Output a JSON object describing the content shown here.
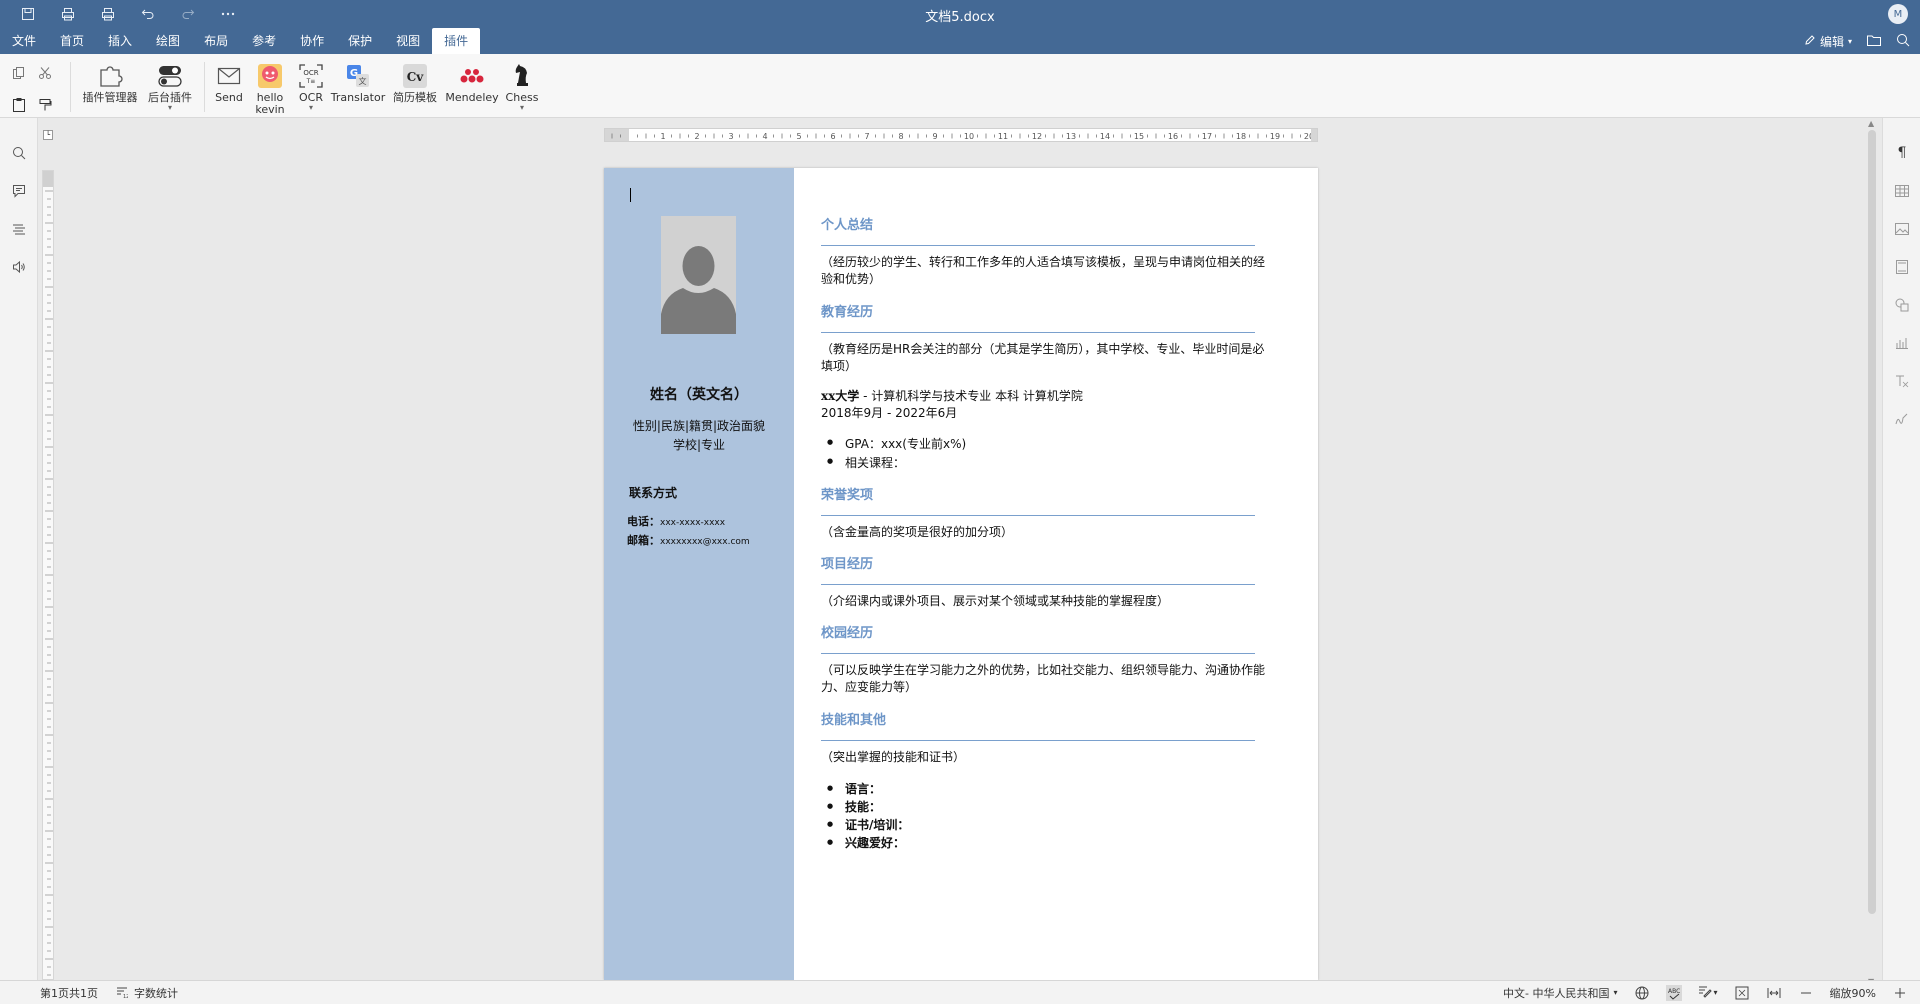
{
  "window": {
    "title": "文档5.docx",
    "user_initial": "M"
  },
  "menu": {
    "items": [
      "文件",
      "首页",
      "插入",
      "绘图",
      "布局",
      "参考",
      "协作",
      "保护",
      "视图",
      "插件"
    ],
    "active": "插件",
    "edit_mode": "编辑"
  },
  "ribbon": {
    "plugins": [
      {
        "label": "插件管理器"
      },
      {
        "label": "后台插件"
      },
      {
        "label": "Send"
      },
      {
        "label": "hello kevin"
      },
      {
        "label": "OCR"
      },
      {
        "label": "Translator"
      },
      {
        "label": "简历模板"
      },
      {
        "label": "Mendeley"
      },
      {
        "label": "Chess"
      }
    ]
  },
  "document": {
    "left": {
      "name": "姓名（英文名）",
      "basic_line1": "性别|民族|籍贯|政治面貌",
      "basic_line2": "学校|专业",
      "contact_title": "联系方式",
      "phone_label": "电话：",
      "phone_value": "xxx-xxxx-xxxx",
      "email_label": "邮箱：",
      "email_value": "xxxxxxxx@xxx.com"
    },
    "sections": {
      "summary_title": "个人总结",
      "summary_text": "（经历较少的学生、转行和工作多年的人适合填写该模板，呈现与申请岗位相关的经验和优势）",
      "education_title": "教育经历",
      "education_text": "（教育经历是HR会关注的部分（尤其是学生简历），其中学校、专业、毕业时间是必填项）",
      "education_school_bold": "xx大学",
      "education_school_rest": " - 计算机科学与技术专业 本科 计算机学院",
      "education_dates": "2018年9月 - 2022年6月",
      "education_bullets": [
        "GPA：xxx(专业前x%)",
        "相关课程："
      ],
      "honors_title": "荣誉奖项",
      "honors_text": "（含金量高的奖项是很好的加分项）",
      "projects_title": "项目经历",
      "projects_text": "（介绍课内或课外项目、展示对某个领域或某种技能的掌握程度）",
      "campus_title": "校园经历",
      "campus_text": "（可以反映学生在学习能力之外的优势，比如社交能力、组织领导能力、沟通协作能力、应变能力等）",
      "skills_title": "技能和其他",
      "skills_text": "（突出掌握的技能和证书）",
      "skills_bullets": [
        "语言：",
        "技能：",
        "证书/培训：",
        "兴趣爱好："
      ]
    }
  },
  "status": {
    "page": "第1页共1页",
    "word_count": "字数统计",
    "language": "中文- 中华人民共和国",
    "zoom": "缩放90%"
  },
  "colors": {
    "titlebar": "#446995",
    "resume_sidebar": "#adc3dd",
    "section_title": "#6e96c8"
  }
}
